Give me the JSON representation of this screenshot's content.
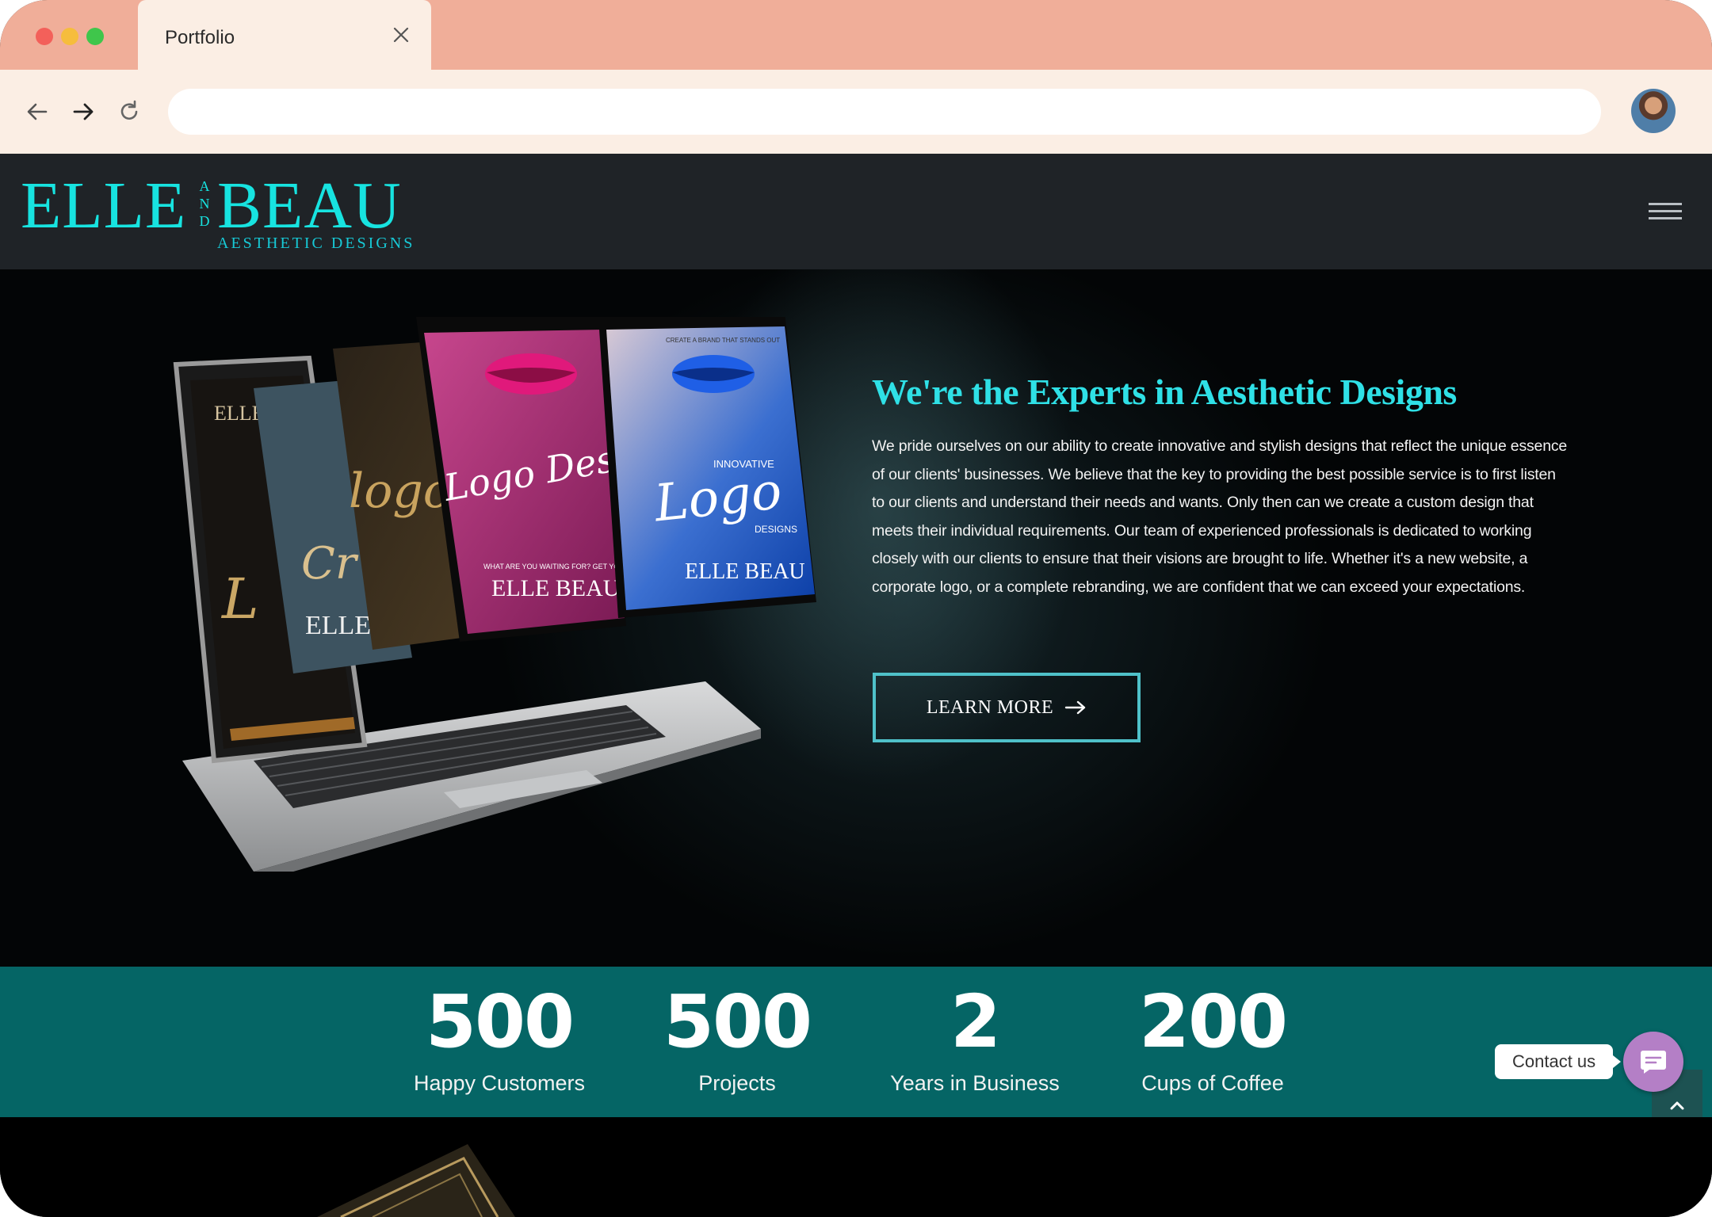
{
  "browser": {
    "tab_title": "Portfolio",
    "address_value": ""
  },
  "site": {
    "logo": {
      "main": "ELLE",
      "and": "A N D",
      "beau": "BEAU",
      "sub": "AESTHETIC DESIGNS"
    }
  },
  "hero": {
    "title": "We're the Experts in Aesthetic Designs",
    "body": "We pride ourselves on our ability to create innovative and stylish designs that reflect the unique essence of our clients' businesses. We believe that the key to providing the best possible service is to first listen to our clients and understand their needs and wants. Only then can we create a custom design that meets their individual requirements. Our team of experienced professionals is dedicated to working closely with our clients to ensure that their visions are brought to life. Whether it's a new website, a corporate logo, or a complete rebranding, we are confident that we can exceed your expectations.",
    "cta_label": "LEARN MORE",
    "art": {
      "card1_script": "Logo Design",
      "card1_brand": "ELLE BEAU",
      "card1_tag": "WHAT ARE YOU WAITING FOR? GET YOUR BUSINESS ONLINE TODAY!",
      "card2_kicker": "CREATE A BRAND THAT STANDS OUT",
      "card2_small": "INNOVATIVE",
      "card2_script": "Logo",
      "card2_sub": "DESIGNS",
      "card2_brand": "ELLE BEAU",
      "card3_script": "logo",
      "screen_brand": "ELLE",
      "screen_script": "L",
      "card4_script": "Cr",
      "card4_brand": "ELLE"
    }
  },
  "stats": [
    {
      "value": "500",
      "label": "Happy Customers"
    },
    {
      "value": "500",
      "label": "Projects"
    },
    {
      "value": "2",
      "label": "Years in Business"
    },
    {
      "value": "200",
      "label": "Cups of Coffee"
    }
  ],
  "contact": {
    "label": "Contact us"
  },
  "colors": {
    "accent": "#17e3e0",
    "stats_bg": "#056565",
    "tabbar": "#f0ae99",
    "chrome": "#fbeee4",
    "header_bg": "#1f2327",
    "cta_border": "#4fc1c9",
    "contact_btn": "#b47fc6"
  },
  "icons": {
    "tab_close": "close-icon",
    "back": "arrow-left-icon",
    "forward": "arrow-right-icon",
    "reload": "reload-icon",
    "menu": "hamburger-icon",
    "cta_arrow": "arrow-right-icon",
    "contact": "chat-icon",
    "scroll_top": "chevron-up-icon"
  }
}
